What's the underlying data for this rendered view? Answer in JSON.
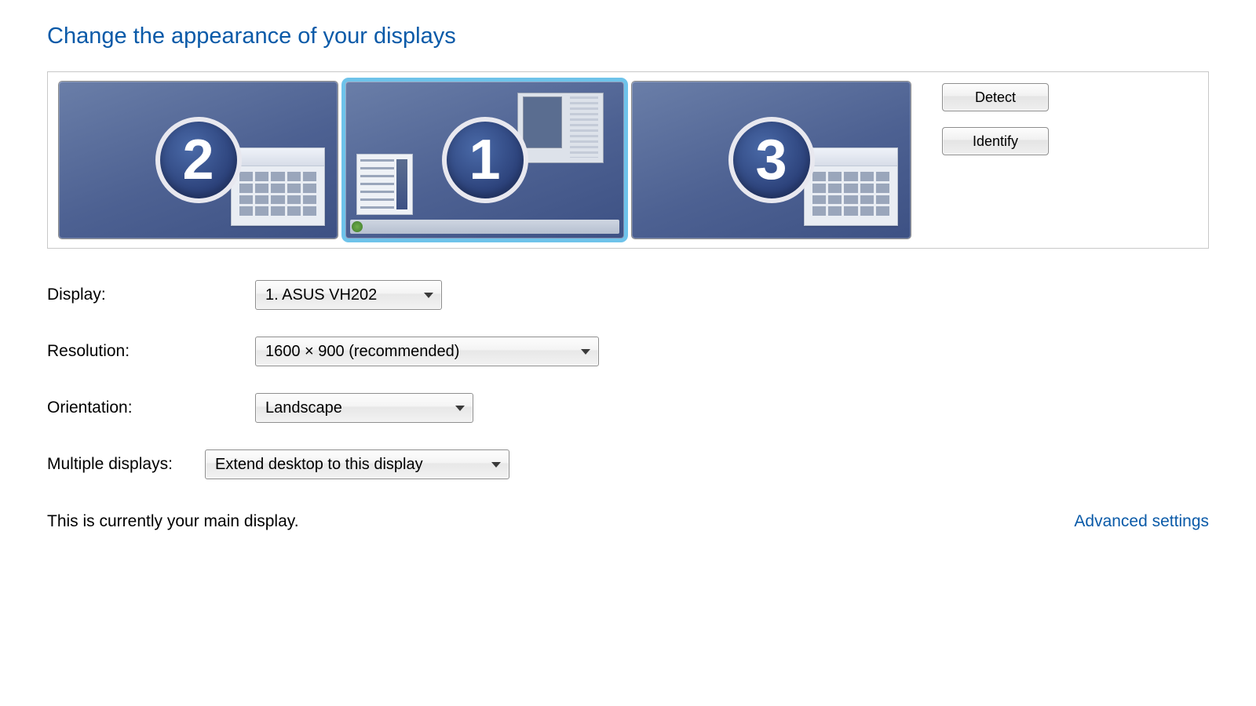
{
  "title": "Change the appearance of your displays",
  "monitors": {
    "m2": {
      "number": "2",
      "selected": false
    },
    "m1": {
      "number": "1",
      "selected": true
    },
    "m3": {
      "number": "3",
      "selected": false
    }
  },
  "buttons": {
    "detect": "Detect",
    "identify": "Identify"
  },
  "labels": {
    "display": "Display:",
    "resolution": "Resolution:",
    "orientation": "Orientation:",
    "multiple_displays": "Multiple displays:"
  },
  "values": {
    "display": "1. ASUS VH202",
    "resolution": "1600 × 900 (recommended)",
    "orientation": "Landscape",
    "multiple_displays": "Extend desktop to this display"
  },
  "status": "This is currently your main display.",
  "advanced_link": "Advanced settings"
}
